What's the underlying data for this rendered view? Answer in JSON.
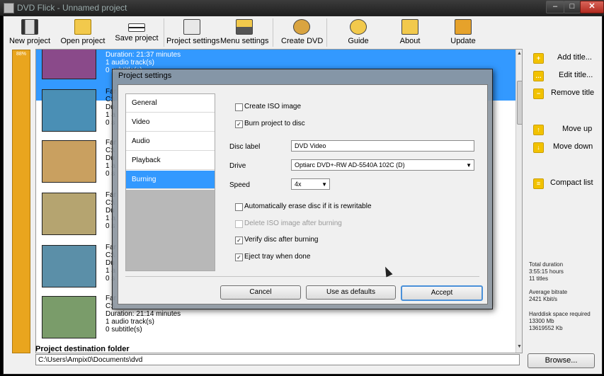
{
  "window": {
    "title": "DVD Flick - Unnamed project",
    "min": "–",
    "max": "□",
    "close": "✕"
  },
  "toolbar": [
    {
      "label": "New project"
    },
    {
      "label": "Open project"
    },
    {
      "label": "Save project"
    },
    {
      "label": "Project settings"
    },
    {
      "label": "Menu settings"
    },
    {
      "label": "Create DVD"
    },
    {
      "label": "Guide"
    },
    {
      "label": "About"
    },
    {
      "label": "Update"
    }
  ],
  "progress": {
    "percent_label": "88%"
  },
  "titles": {
    "rows": [
      {
        "lines": [
          "Duration: 21:37 minutes",
          "1 audio track(s)",
          "0 subtitle(s)"
        ]
      },
      {
        "lines": [
          "Far",
          "C:\\",
          "Du",
          "1 a",
          "0 s"
        ]
      },
      {
        "lines": [
          "Far",
          "C:\\",
          "Du",
          "1 a",
          "0 s"
        ]
      },
      {
        "lines": [
          "Far",
          "C:\\",
          "Du",
          "1 a",
          "0 s"
        ]
      },
      {
        "lines": [
          "Far",
          "C:\\",
          "Du",
          "1 a",
          "0 s"
        ]
      },
      {
        "lines": [
          "Far",
          "C:\\",
          "Duration: 21:14 minutes",
          "1 audio track(s)",
          "0 subtitle(s)"
        ]
      }
    ]
  },
  "sidebar": {
    "add_title": "Add title...",
    "edit_title": "Edit title...",
    "remove_title": "Remove title",
    "move_up": "Move up",
    "move_down": "Move down",
    "compact_list": "Compact list"
  },
  "stats": {
    "total_duration_label": "Total duration",
    "total_duration_hours": "3:55:15 hours",
    "total_titles": "11 titles",
    "avg_bitrate_label": "Average bitrate",
    "avg_bitrate": "2421 Kbit/s",
    "harddisk_label": "Harddisk space required",
    "harddisk_mb": "13300 Mb",
    "harddisk_kb": "13619552 Kb"
  },
  "destination": {
    "label": "Project destination folder",
    "value": "C:\\Users\\Ampix0\\Documents\\dvd",
    "browse": "Browse..."
  },
  "dialog": {
    "title": "Project settings",
    "nav": [
      "General",
      "Video",
      "Audio",
      "Playback",
      "Burning"
    ],
    "create_iso": "Create ISO image",
    "burn_to_disc": "Burn project to disc",
    "disc_label_label": "Disc label",
    "disc_label_value": "DVD Video",
    "drive_label": "Drive",
    "drive_value": "Optiarc DVD+-RW AD-5540A 102C (D)",
    "speed_label": "Speed",
    "speed_value": "4x",
    "auto_erase": "Automatically erase disc if it is rewritable",
    "delete_iso": "Delete ISO image after burning",
    "verify": "Verify disc after burning",
    "eject": "Eject tray when done",
    "cancel": "Cancel",
    "use_defaults": "Use as defaults",
    "accept": "Accept",
    "checked_mark": "✓"
  }
}
